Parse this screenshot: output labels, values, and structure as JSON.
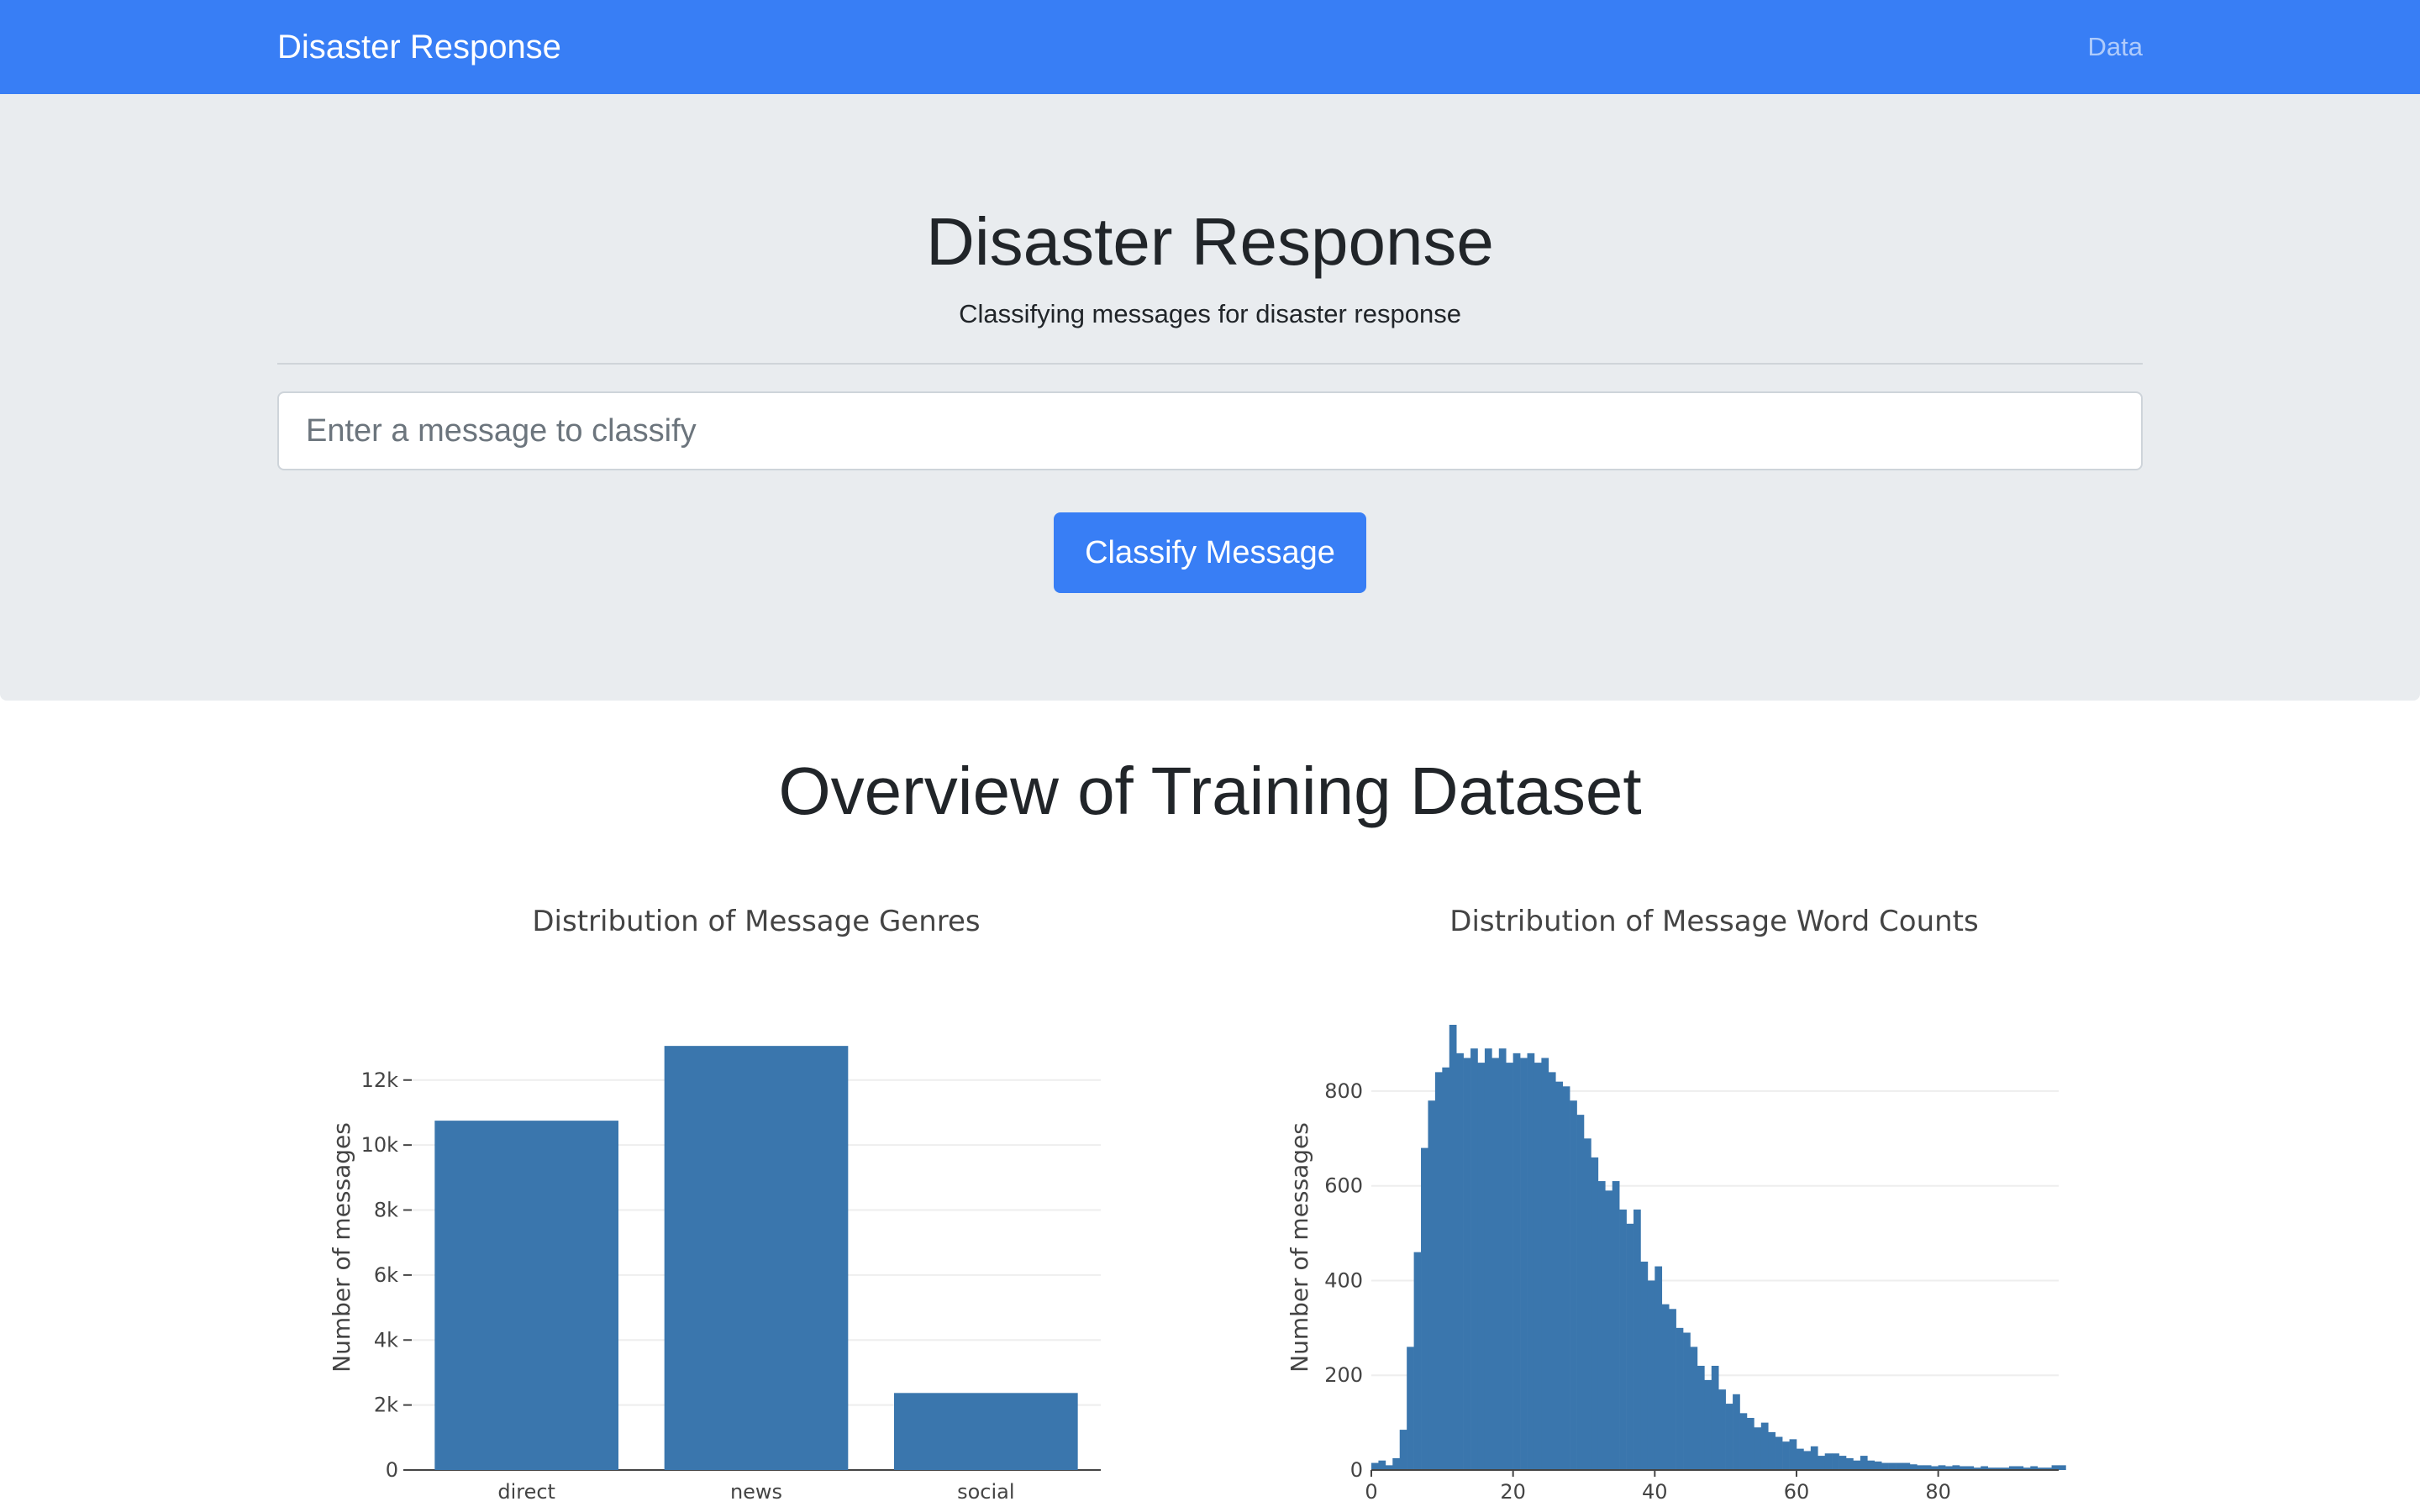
{
  "navbar": {
    "brand": "Disaster Response",
    "data_link": "Data",
    "color": "#387ef5"
  },
  "jumbotron": {
    "title": "Disaster Response",
    "subtitle": "Classifying messages for disaster response",
    "input_placeholder": "Enter a message to classify",
    "button_label": "Classify Message"
  },
  "overview": {
    "heading": "Overview of Training Dataset"
  },
  "chart_data": [
    {
      "type": "bar",
      "title": "Distribution of Message Genres",
      "xlabel": "",
      "ylabel": "Number of messages",
      "categories": [
        "direct",
        "news",
        "social"
      ],
      "values": [
        10750,
        13050,
        2370
      ],
      "ylim": [
        0,
        13700
      ],
      "yticks": [
        0,
        2000,
        4000,
        6000,
        8000,
        10000,
        12000
      ],
      "ytick_labels": [
        "0",
        "2k",
        "4k",
        "6k",
        "8k",
        "10k",
        "12k"
      ],
      "color": "#3a76ad",
      "grid": true
    },
    {
      "type": "bar",
      "title": "Distribution of Message Word Counts",
      "xlabel": "",
      "ylabel": "Number of messages",
      "bin_start": 0,
      "bin_width": 1,
      "values": [
        15,
        20,
        10,
        25,
        85,
        260,
        460,
        680,
        780,
        840,
        850,
        940,
        880,
        870,
        890,
        860,
        890,
        870,
        890,
        860,
        880,
        870,
        880,
        860,
        870,
        840,
        820,
        810,
        780,
        750,
        700,
        660,
        610,
        590,
        610,
        550,
        520,
        550,
        440,
        400,
        430,
        350,
        340,
        300,
        290,
        260,
        220,
        190,
        220,
        170,
        140,
        160,
        120,
        110,
        90,
        100,
        80,
        70,
        60,
        65,
        45,
        40,
        50,
        30,
        35,
        35,
        30,
        25,
        20,
        30,
        20,
        18,
        15,
        15,
        15,
        15,
        12,
        10,
        10,
        8,
        10,
        8,
        10,
        8,
        8,
        5,
        8,
        5,
        5,
        5,
        8,
        8,
        5,
        8,
        5,
        5,
        10,
        10
      ],
      "xlim": [
        0,
        97
      ],
      "xticks": [
        0,
        20,
        40,
        60,
        80
      ],
      "ylim": [
        0,
        940
      ],
      "yticks": [
        0,
        200,
        400,
        600,
        800
      ],
      "color": "#3a76ad",
      "grid": true
    }
  ]
}
